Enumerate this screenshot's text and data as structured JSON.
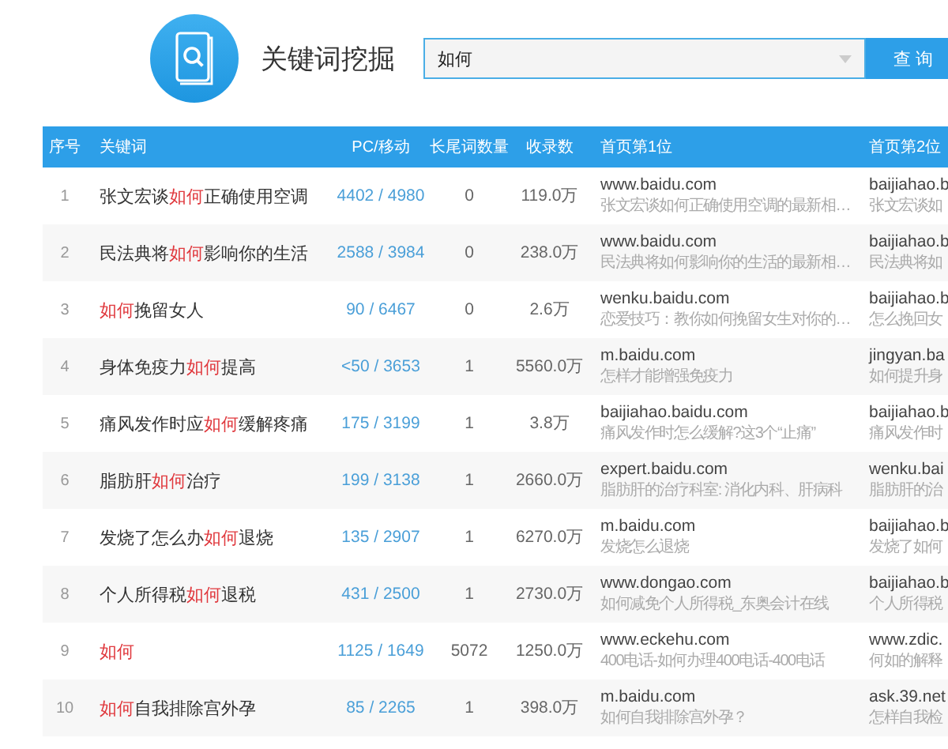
{
  "header": {
    "title": "关键词挖掘",
    "search": {
      "value": "如何"
    },
    "search_button": "查 询"
  },
  "table": {
    "columns": [
      "序号",
      "关键词",
      "PC/移动",
      "长尾词数量",
      "收录数",
      "首页第1位",
      "首页第2位"
    ],
    "rows": [
      {
        "index": "1",
        "keyword_parts": [
          {
            "text": "张文宏谈",
            "highlight": false
          },
          {
            "text": "如何",
            "highlight": true
          },
          {
            "text": "正确使用空调",
            "highlight": false
          }
        ],
        "pc_mobile": "4402 / 4980",
        "long_tail_count": "0",
        "indexed_count": "119.0万",
        "rank_1": {
          "domain": "www.baidu.com",
          "snippet": "张文宏谈如何正确使用空调的最新相…"
        },
        "rank_2": {
          "domain": "baijiahao.b",
          "snippet": "张文宏谈如"
        }
      },
      {
        "index": "2",
        "keyword_parts": [
          {
            "text": "民法典将",
            "highlight": false
          },
          {
            "text": "如何",
            "highlight": true
          },
          {
            "text": "影响你的生活",
            "highlight": false
          }
        ],
        "pc_mobile": "2588 / 3984",
        "long_tail_count": "0",
        "indexed_count": "238.0万",
        "rank_1": {
          "domain": "www.baidu.com",
          "snippet": "民法典将如何影响你的生活的最新相…"
        },
        "rank_2": {
          "domain": "baijiahao.b",
          "snippet": "民法典将如"
        }
      },
      {
        "index": "3",
        "keyword_parts": [
          {
            "text": "如何",
            "highlight": true
          },
          {
            "text": "挽留女人",
            "highlight": false
          }
        ],
        "pc_mobile": "90 / 6467",
        "long_tail_count": "0",
        "indexed_count": "2.6万",
        "rank_1": {
          "domain": "wenku.baidu.com",
          "snippet": "恋爱技巧：教你如何挽留女生对你的…"
        },
        "rank_2": {
          "domain": "baijiahao.b",
          "snippet": "怎么挽回女"
        }
      },
      {
        "index": "4",
        "keyword_parts": [
          {
            "text": "身体免疫力",
            "highlight": false
          },
          {
            "text": "如何",
            "highlight": true
          },
          {
            "text": "提高",
            "highlight": false
          }
        ],
        "pc_mobile": "<50 / 3653",
        "long_tail_count": "1",
        "indexed_count": "5560.0万",
        "rank_1": {
          "domain": "m.baidu.com",
          "snippet": "怎样才能增强免疫力"
        },
        "rank_2": {
          "domain": "jingyan.ba",
          "snippet": "如何提升身"
        }
      },
      {
        "index": "5",
        "keyword_parts": [
          {
            "text": "痛风发作时应",
            "highlight": false
          },
          {
            "text": "如何",
            "highlight": true
          },
          {
            "text": "缓解疼痛",
            "highlight": false
          }
        ],
        "pc_mobile": "175 / 3199",
        "long_tail_count": "1",
        "indexed_count": "3.8万",
        "rank_1": {
          "domain": "baijiahao.baidu.com",
          "snippet": "痛风发作时怎么缓解?这3个“止痛”"
        },
        "rank_2": {
          "domain": "baijiahao.b",
          "snippet": "痛风发作时"
        }
      },
      {
        "index": "6",
        "keyword_parts": [
          {
            "text": "脂肪肝",
            "highlight": false
          },
          {
            "text": "如何",
            "highlight": true
          },
          {
            "text": "治疗",
            "highlight": false
          }
        ],
        "pc_mobile": "199 / 3138",
        "long_tail_count": "1",
        "indexed_count": "2660.0万",
        "rank_1": {
          "domain": "expert.baidu.com",
          "snippet": "脂肪肝的治疗科室: 消化内科、肝病科"
        },
        "rank_2": {
          "domain": "wenku.bai",
          "snippet": "脂肪肝的治"
        }
      },
      {
        "index": "7",
        "keyword_parts": [
          {
            "text": "发烧了怎么办",
            "highlight": false
          },
          {
            "text": "如何",
            "highlight": true
          },
          {
            "text": "退烧",
            "highlight": false
          }
        ],
        "pc_mobile": "135 / 2907",
        "long_tail_count": "1",
        "indexed_count": "6270.0万",
        "rank_1": {
          "domain": "m.baidu.com",
          "snippet": "发烧怎么退烧"
        },
        "rank_2": {
          "domain": "baijiahao.b",
          "snippet": "发烧了如何"
        }
      },
      {
        "index": "8",
        "keyword_parts": [
          {
            "text": "个人所得税",
            "highlight": false
          },
          {
            "text": "如何",
            "highlight": true
          },
          {
            "text": "退税",
            "highlight": false
          }
        ],
        "pc_mobile": "431 / 2500",
        "long_tail_count": "1",
        "indexed_count": "2730.0万",
        "rank_1": {
          "domain": "www.dongao.com",
          "snippet": "如何减免个人所得税_东奥会计在线"
        },
        "rank_2": {
          "domain": "baijiahao.b",
          "snippet": "个人所得税"
        }
      },
      {
        "index": "9",
        "keyword_parts": [
          {
            "text": "如何",
            "highlight": true
          }
        ],
        "pc_mobile": "1125 / 1649",
        "long_tail_count": "5072",
        "indexed_count": "1250.0万",
        "rank_1": {
          "domain": "www.eckehu.com",
          "snippet": "400电话-如何办理400电话-400电话"
        },
        "rank_2": {
          "domain": "www.zdic.",
          "snippet": "何如的解释"
        }
      },
      {
        "index": "10",
        "keyword_parts": [
          {
            "text": "如何",
            "highlight": true
          },
          {
            "text": "自我排除宫外孕",
            "highlight": false
          }
        ],
        "pc_mobile": "85 / 2265",
        "long_tail_count": "1",
        "indexed_count": "398.0万",
        "rank_1": {
          "domain": "m.baidu.com",
          "snippet": "如何自我排除宫外孕？"
        },
        "rank_2": {
          "domain": "ask.39.net",
          "snippet": "怎样自我检"
        }
      }
    ]
  }
}
